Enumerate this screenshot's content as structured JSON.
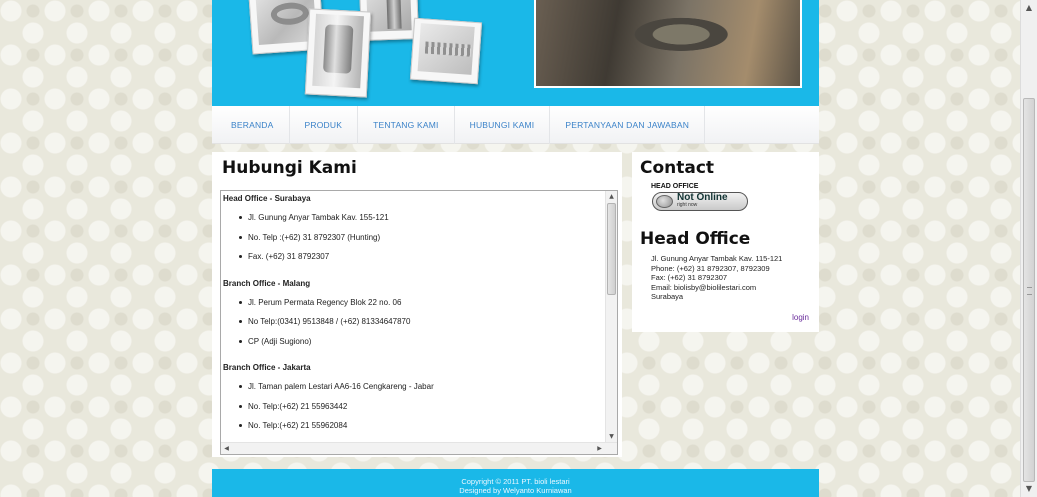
{
  "nav": {
    "items": [
      {
        "label": "BERANDA"
      },
      {
        "label": "PRODUK"
      },
      {
        "label": "TENTANG KAMI"
      },
      {
        "label": "HUBUNGI KAMI"
      },
      {
        "label": "PERTANYAAN DAN JAWABAN"
      }
    ]
  },
  "main": {
    "title": "Hubungi Kami",
    "sections": [
      {
        "title": "Head Office - Surabaya",
        "items": [
          "Jl. Gunung Anyar Tambak Kav. 155-121",
          "No. Telp :(+62) 31 8792307 (Hunting)",
          "Fax. (+62) 31 8792307"
        ]
      },
      {
        "title": "Branch Office - Malang",
        "items": [
          "Jl. Perum Permata Regency Blok 22 no. 06",
          "No Telp:(0341) 9513848 / (+62) 81334647870",
          "CP (Adji Sugiono)"
        ]
      },
      {
        "title": "Branch Office - Jakarta",
        "items": [
          "Jl. Taman palem Lestari AA6-16 Cengkareng - Jabar",
          "No. Telp:(+62) 21 55963442",
          "No. Telp:(+62) 21 55962084"
        ]
      }
    ]
  },
  "sidebar": {
    "contact_title": "Contact",
    "head_office_label": "HEAD OFFICE",
    "status": {
      "main": "Not Online",
      "sub": "right now"
    },
    "head_office_title": "Head Office",
    "address": {
      "line1": "Jl. Gunung Anyar Tambak Kav. 115-121",
      "phone": "Phone: (+62) 31 8792307, 8792309",
      "fax": "Fax: (+62) 31 8792307",
      "email": "Email: biolisby@biolilestari.com",
      "city": "Surabaya"
    },
    "login_label": "login"
  },
  "footer": {
    "copyright": "Copyright © 2011 PT. bioli lestari",
    "designer": "Designed by Welyanto Kurniawan"
  },
  "colors": {
    "banner": "#1ab8e8",
    "nav_link": "#3a82c8",
    "login_link": "#6a2c9c"
  }
}
